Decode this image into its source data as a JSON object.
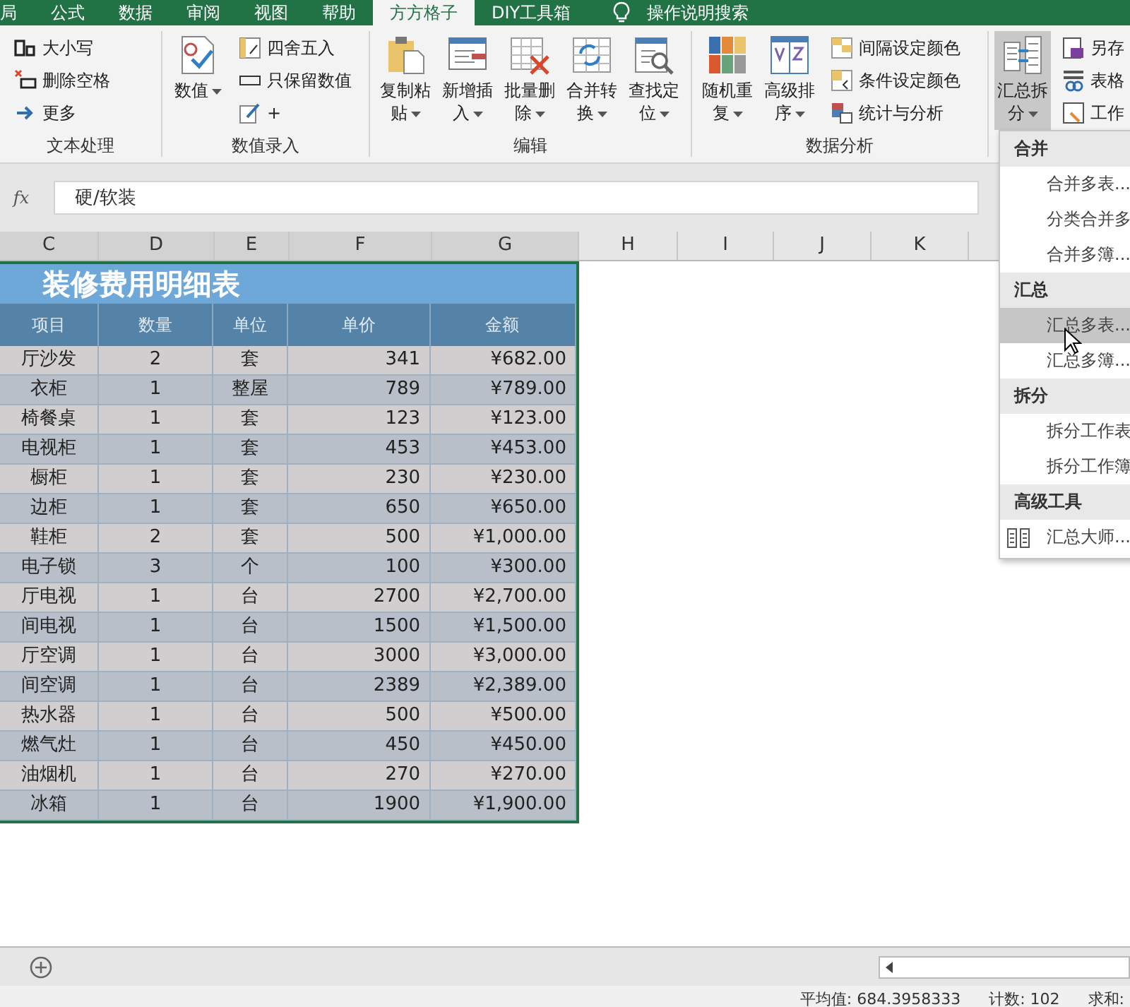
{
  "ribbon": {
    "tabs": [
      {
        "label": "局",
        "selected": false
      },
      {
        "label": "公式",
        "selected": false
      },
      {
        "label": "数据",
        "selected": false
      },
      {
        "label": "审阅",
        "selected": false
      },
      {
        "label": "视图",
        "selected": false
      },
      {
        "label": "帮助",
        "selected": false
      },
      {
        "label": "方方格子",
        "selected": true
      },
      {
        "label": "DIY工具箱",
        "selected": false
      }
    ],
    "tell_me": "操作说明搜索",
    "groups": [
      {
        "label": "文本处理",
        "items": [
          "大小写",
          "删除空格",
          "更多"
        ]
      },
      {
        "label": "数值录入",
        "big_buttons": [
          {
            "label": "数值",
            "expanded": false
          }
        ],
        "items": [
          "四舍五入",
          "只保留数值",
          "+"
        ]
      },
      {
        "label": "编辑",
        "big_buttons": [
          {
            "label": "复制粘贴",
            "expanded": false
          },
          {
            "label": "新增插入",
            "expanded": false
          },
          {
            "label": "批量删除",
            "expanded": false
          },
          {
            "label": "合并转换",
            "expanded": false
          },
          {
            "label": "查找定位",
            "expanded": false
          }
        ]
      },
      {
        "label": "数据分析",
        "big_buttons": [
          {
            "label": "随机重复",
            "expanded": false
          },
          {
            "label": "高级排序",
            "expanded": false
          }
        ],
        "items": [
          "间隔设定颜色",
          "条件设定颜色",
          "统计与分析"
        ]
      },
      {
        "big_buttons": [
          {
            "label": "汇总拆分",
            "expanded": true
          }
        ],
        "items": [
          "另存",
          "表格",
          "工作"
        ]
      }
    ]
  },
  "formula_bar": {
    "fx": "fx",
    "value": "硬/软装"
  },
  "sheet": {
    "columns": [
      "C",
      "D",
      "E",
      "F",
      "G",
      "H",
      "I",
      "J",
      "K"
    ],
    "title": "装修费用明细表",
    "headers": [
      "项目",
      "数量",
      "单位",
      "单价",
      "金额"
    ],
    "rows": [
      [
        "厅沙发",
        "2",
        "套",
        "341",
        "¥682.00"
      ],
      [
        "衣柜",
        "1",
        "整屋",
        "789",
        "¥789.00"
      ],
      [
        "椅餐桌",
        "1",
        "套",
        "123",
        "¥123.00"
      ],
      [
        "电视柜",
        "1",
        "套",
        "453",
        "¥453.00"
      ],
      [
        "橱柜",
        "1",
        "套",
        "230",
        "¥230.00"
      ],
      [
        "边柜",
        "1",
        "套",
        "650",
        "¥650.00"
      ],
      [
        "鞋柜",
        "2",
        "套",
        "500",
        "¥1,000.00"
      ],
      [
        "电子锁",
        "3",
        "个",
        "100",
        "¥300.00"
      ],
      [
        "厅电视",
        "1",
        "台",
        "2700",
        "¥2,700.00"
      ],
      [
        "间电视",
        "1",
        "台",
        "1500",
        "¥1,500.00"
      ],
      [
        "厅空调",
        "1",
        "台",
        "3000",
        "¥3,000.00"
      ],
      [
        "间空调",
        "1",
        "台",
        "2389",
        "¥2,389.00"
      ],
      [
        "热水器",
        "1",
        "台",
        "500",
        "¥500.00"
      ],
      [
        "燃气灶",
        "1",
        "台",
        "450",
        "¥450.00"
      ],
      [
        "油烟机",
        "1",
        "台",
        "270",
        "¥270.00"
      ],
      [
        "冰箱",
        "1",
        "台",
        "1900",
        "¥1,900.00"
      ]
    ]
  },
  "menu": {
    "sections": [
      {
        "title": "合并",
        "items": [
          {
            "label": "合并多表...",
            "kind": "plain",
            "highlighted": false
          },
          {
            "label": "分类合并多",
            "kind": "plain",
            "highlighted": false
          },
          {
            "label": "合并多簿...",
            "kind": "plain",
            "highlighted": false
          }
        ]
      },
      {
        "title": "汇总",
        "items": [
          {
            "label": "汇总多表...",
            "kind": "plain",
            "highlighted": true
          },
          {
            "label": "汇总多簿...",
            "kind": "plain",
            "highlighted": false
          }
        ]
      },
      {
        "title": "拆分",
        "items": [
          {
            "label": "拆分工作表",
            "kind": "plain",
            "highlighted": false
          },
          {
            "label": "拆分工作簿",
            "kind": "plain",
            "highlighted": false
          }
        ]
      },
      {
        "title": "高级工具",
        "items": [
          {
            "label": "汇总大师...",
            "kind": "icon",
            "highlighted": false
          }
        ]
      }
    ]
  },
  "status_bar": [
    "平均值: 684.3958333",
    "计数: 102",
    "求和:"
  ]
}
